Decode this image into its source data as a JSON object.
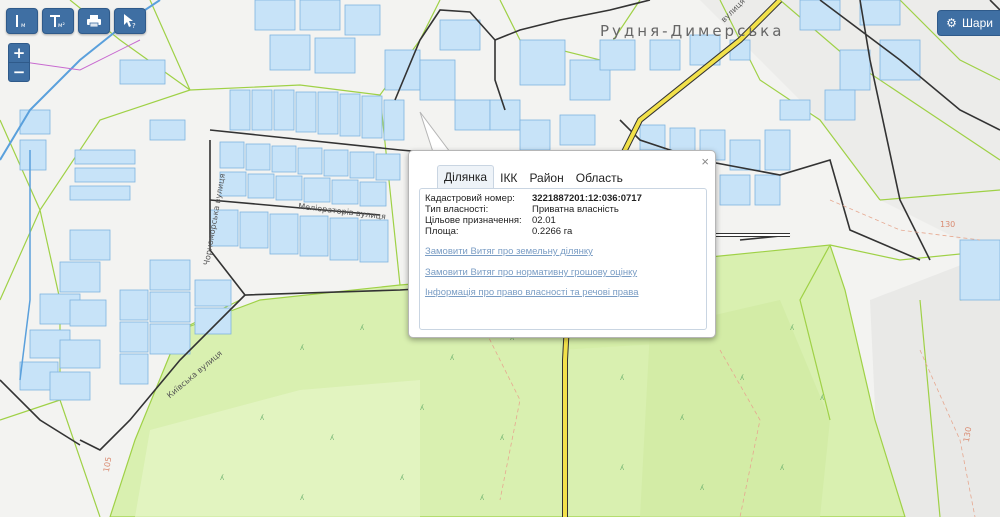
{
  "toolbar": {
    "buttons": [
      {
        "name": "measure-distance-button",
        "icon": "ruler-m-icon",
        "label": "м"
      },
      {
        "name": "measure-area-button",
        "icon": "ruler-m2-icon",
        "label": "м²"
      },
      {
        "name": "print-button",
        "icon": "printer-icon",
        "label": ""
      },
      {
        "name": "identify-button",
        "icon": "cursor-question-icon",
        "label": "?"
      }
    ]
  },
  "zoom": {
    "in_label": "+",
    "out_label": "−"
  },
  "layers_button": {
    "label": "Шари",
    "icon": "gear-icon"
  },
  "map": {
    "place_name": "Рудня-Димерська",
    "streets": [
      {
        "key": "melioratoriv",
        "label": "Меліораторів вулиця"
      },
      {
        "key": "chornomorska",
        "label": "Чорноморська вулиця"
      },
      {
        "key": "kyivska",
        "label": "Київська вулиця"
      },
      {
        "key": "vulytsia_top",
        "label": "вулиця"
      }
    ],
    "elevations": [
      "130",
      "130",
      "105"
    ]
  },
  "popup": {
    "close_label": "×",
    "tabs": [
      "Ділянка",
      "ІКК",
      "Район",
      "Область"
    ],
    "active_tab": "Ділянка",
    "fields": [
      {
        "label": "Кадастровий номер:",
        "value": "3221887201:12:036:0717",
        "bold": true
      },
      {
        "label": "Тип власності:",
        "value": "Приватна власність",
        "bold": false
      },
      {
        "label": "Цільове призначення:",
        "value": "02.01",
        "bold": false
      },
      {
        "label": "Площа:",
        "value": "0.2266 га",
        "bold": false
      }
    ],
    "links": [
      "Замовити Витяг про земельну ділянку",
      "Замовити Витяг про нормативну грошову оцінку",
      "Інформація про право власності та речові права"
    ]
  },
  "colors": {
    "parcel_fill": "#c7e3f8",
    "parcel_stroke": "#7fb3df",
    "boundary_green": "#9fd146",
    "forest_fill": "#d9f0b0",
    "road_yellow": "#f2e14a",
    "road_outline": "#333333",
    "button_blue": "#3f6fa3"
  }
}
